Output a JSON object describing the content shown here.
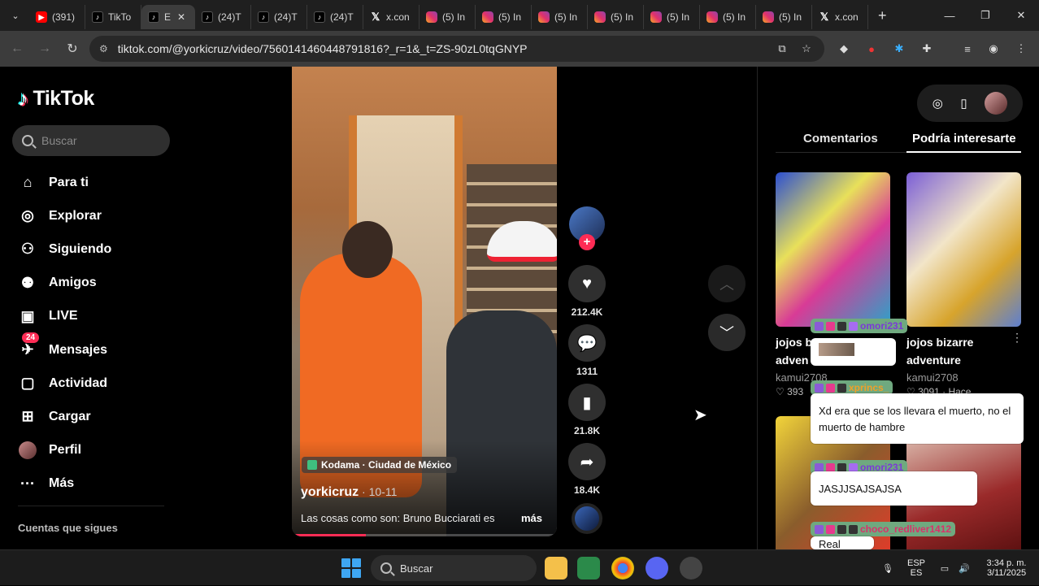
{
  "browser": {
    "tabs": [
      {
        "icon": "youtube-icon",
        "label": "(391)"
      },
      {
        "icon": "tiktok-icon",
        "label": "TikTo"
      },
      {
        "icon": "tiktok-icon",
        "label": "E",
        "active": true
      },
      {
        "icon": "tiktok-icon",
        "label": "(24)T"
      },
      {
        "icon": "tiktok-icon",
        "label": "(24)T"
      },
      {
        "icon": "tiktok-icon",
        "label": "(24)T"
      },
      {
        "icon": "x-icon",
        "label": "x.con"
      },
      {
        "icon": "instagram-icon",
        "label": "(5) In"
      },
      {
        "icon": "instagram-icon",
        "label": "(5) In"
      },
      {
        "icon": "instagram-icon",
        "label": "(5) In"
      },
      {
        "icon": "instagram-icon",
        "label": "(5) In"
      },
      {
        "icon": "instagram-icon",
        "label": "(5) In"
      },
      {
        "icon": "instagram-icon",
        "label": "(5) In"
      },
      {
        "icon": "instagram-icon",
        "label": "(5) In"
      },
      {
        "icon": "x-icon",
        "label": "x.con"
      }
    ],
    "url": "tiktok.com/@yorkicruz/video/7560141460448791816?_r=1&_t=ZS-90zL0tqGNYP"
  },
  "sidebar": {
    "brand": "TikTok",
    "search_placeholder": "Buscar",
    "items": [
      {
        "label": "Para ti",
        "icon": "home-icon"
      },
      {
        "label": "Explorar",
        "icon": "compass-icon"
      },
      {
        "label": "Siguiendo",
        "icon": "following-icon"
      },
      {
        "label": "Amigos",
        "icon": "friends-icon"
      },
      {
        "label": "LIVE",
        "icon": "live-icon"
      },
      {
        "label": "Mensajes",
        "icon": "messages-icon",
        "badge": "24"
      },
      {
        "label": "Actividad",
        "icon": "activity-icon"
      },
      {
        "label": "Cargar",
        "icon": "upload-icon"
      },
      {
        "label": "Perfil",
        "icon": "profile-avatar"
      },
      {
        "label": "Más",
        "icon": "more-icon"
      }
    ],
    "following_heading": "Cuentas que sigues"
  },
  "video": {
    "location": "Kodama · Ciudad de México",
    "author": "yorkicruz",
    "date": " · 10-11",
    "caption": "Las cosas como son: Bruno Bucciarati es",
    "more": "más",
    "progress": 0.28
  },
  "actions": {
    "likes": "212.4K",
    "comments": "1311",
    "saves": "21.8K",
    "shares": "18.4K"
  },
  "right_panel": {
    "tabs": [
      "Comentarios",
      "Podría interesarte"
    ],
    "active_tab": "Podría interesarte",
    "cards": [
      {
        "title": "jojos b",
        "title2": "adven",
        "user": "kamui2708",
        "likes": "393"
      },
      {
        "title": "jojos bizarre",
        "title2": "adventure",
        "user": "kamui2708",
        "likes": "3091",
        "time": "· Hace"
      }
    ]
  },
  "chat_overlay": [
    {
      "user": "omori231",
      "message": ""
    },
    {
      "user": "xprincs_",
      "message": "Xd era que se los llevara el muerto, no el muerto de hambre"
    },
    {
      "user": "omori231",
      "message": "JASJJSAJSAJSA"
    },
    {
      "user": "choco_redliver1412",
      "message": "Real"
    }
  ],
  "taskbar": {
    "search_label": "Buscar",
    "lang": "ESP",
    "lang2": "ES",
    "time": "3:34 p. m.",
    "date": "3/11/2025"
  }
}
